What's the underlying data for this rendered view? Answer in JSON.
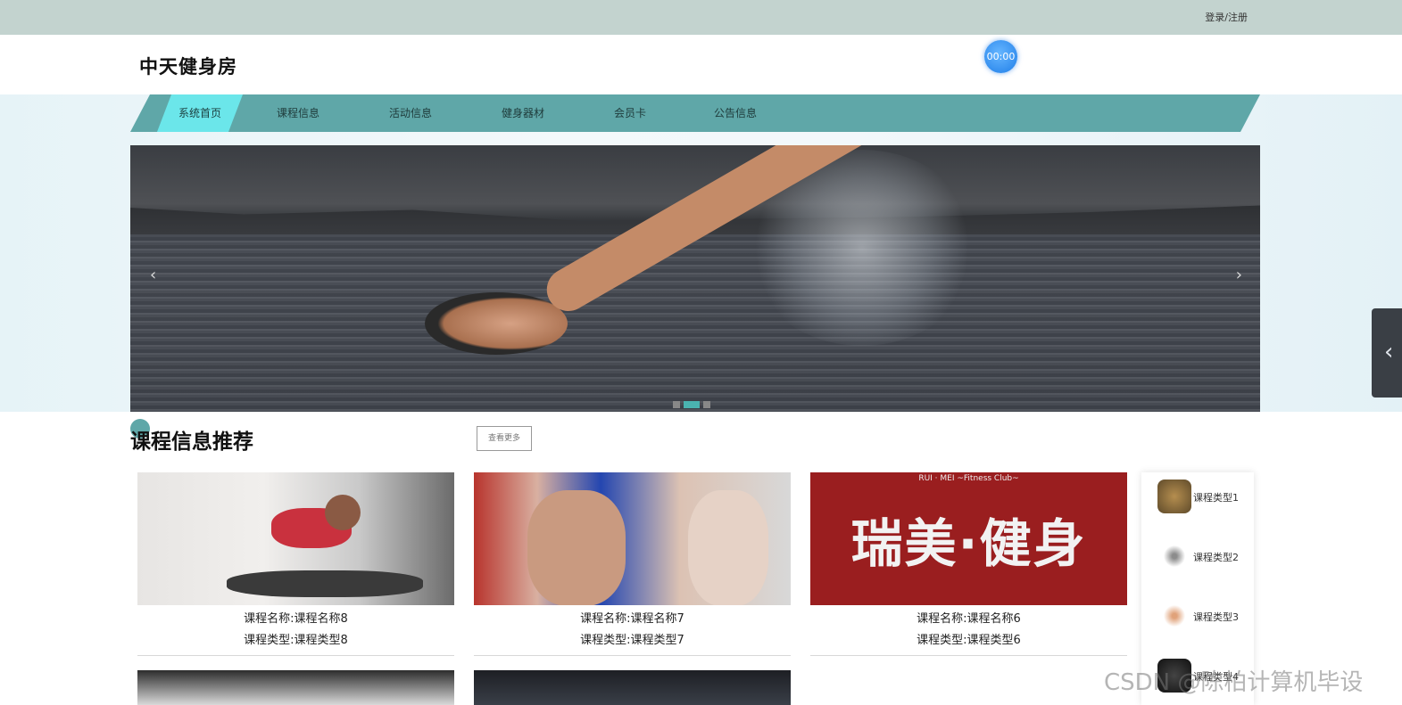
{
  "topbar": {
    "login_label": "登录/注册"
  },
  "header": {
    "site_title": "中天健身房",
    "clock_text": "00:00"
  },
  "nav": {
    "items": [
      {
        "label": "系统首页",
        "active": true
      },
      {
        "label": "课程信息",
        "active": false
      },
      {
        "label": "活动信息",
        "active": false
      },
      {
        "label": "健身器材",
        "active": false
      },
      {
        "label": "会员卡",
        "active": false
      },
      {
        "label": "公告信息",
        "active": false
      }
    ]
  },
  "banner": {
    "prev_icon": "‹",
    "next_icon": "›",
    "slides_count": 3,
    "active_slide": 2
  },
  "section": {
    "title": "课程信息推荐",
    "more_label": "查看更多"
  },
  "courses": [
    {
      "name_line": "课程名称:课程名称8",
      "type_line": "课程类型:课程类型8"
    },
    {
      "name_line": "课程名称:课程名称7",
      "type_line": "课程类型:课程类型7"
    },
    {
      "name_line": "课程名称:课程名称6",
      "type_line": "课程类型:课程类型6"
    }
  ],
  "course3_image_text": {
    "main": "瑞美·健身",
    "sub": "RUI · MEI ~Fitness Club~"
  },
  "type_panel": {
    "items": [
      {
        "label": "课程类型1"
      },
      {
        "label": "课程类型2"
      },
      {
        "label": "课程类型3"
      },
      {
        "label": "课程类型4"
      }
    ]
  },
  "side_tab": {
    "icon": "‹"
  },
  "watermark": "CSDN @陈柏计算机毕设",
  "colors": {
    "topbar": "#c3d3cf",
    "nav": "#5fa7a8",
    "nav_active": "#6be6ea",
    "accent": "#4ab3b0"
  }
}
